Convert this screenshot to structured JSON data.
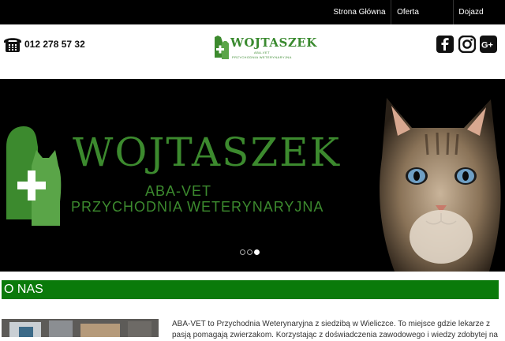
{
  "nav": {
    "items": [
      "Strona Główna",
      "Oferta",
      "Dojazd"
    ]
  },
  "header": {
    "phone": "012 278 57 32",
    "logo": {
      "title": "WOJTASZEK",
      "sub1": "ABA-VET",
      "sub2": "PRZYCHODNIA WETERYNARYJNA"
    },
    "social": [
      "facebook-icon",
      "instagram-icon",
      "google-plus-icon"
    ]
  },
  "hero": {
    "title": "WOJTASZEK",
    "sub1": "ABA-VET",
    "sub2": "PRZYCHODNIA WETERYNARYJNA",
    "slide_count": 3,
    "active_slide": 3
  },
  "about": {
    "heading": "O NAS",
    "text": "ABA-VET to Przychodnia Weterynaryjna z siedzibą w Wieliczce. To miejsce gdzie lekarze z pasją pomagają zwierzakom. Korzystając z doświadczenia zawodowego i wiedzy zdobytej na"
  },
  "colors": {
    "brand_green": "#3c8a2e",
    "section_green": "#0a7a0a",
    "nav_bg": "#000000"
  }
}
